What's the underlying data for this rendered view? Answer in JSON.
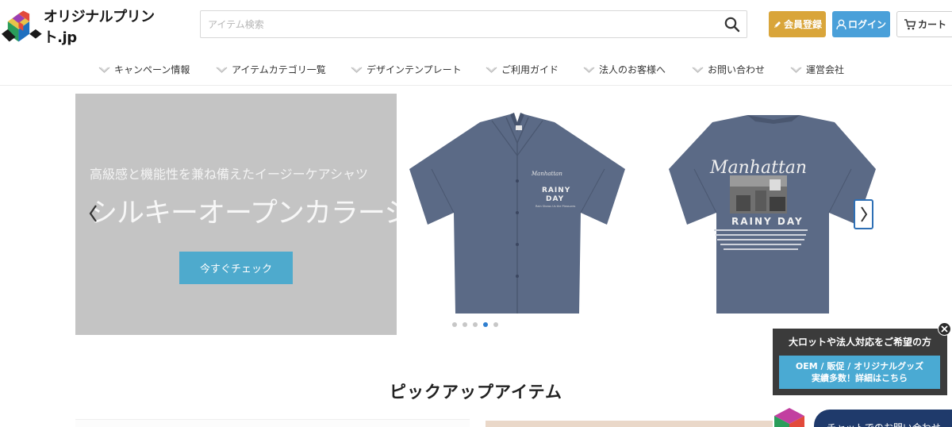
{
  "header": {
    "logo_text": "オリジナルプリント.jp",
    "search_placeholder": "アイテム検索",
    "register_label": "会員登録",
    "login_label": "ログイン",
    "cart_label": "カート"
  },
  "nav": {
    "items": [
      {
        "label": "キャンペーン情報"
      },
      {
        "label": "アイテムカテゴリ一覧"
      },
      {
        "label": "デザインテンプレート"
      },
      {
        "label": "ご利用ガイド"
      },
      {
        "label": "法人のお客様へ"
      },
      {
        "label": "お問い合わせ"
      },
      {
        "label": "運営会社"
      }
    ]
  },
  "hero": {
    "subtitle": "高級感と機能性を兼ね備えたイージーケアシャツ",
    "title": "シルキーオープンカラーシャツ",
    "cta_label": "今すぐチェック",
    "shirt_front_text_1": "RAINY",
    "shirt_front_text_2": "DAY",
    "shirt_back_script": "Manhattan",
    "shirt_back_text": "RAINY DAY",
    "slide_count": 5,
    "active_slide": 4
  },
  "pickup": {
    "title": "ピックアップアイテム"
  },
  "corporate_popup": {
    "title": "大ロットや法人対応をご希望の方",
    "button_line1": "OEM / 販促 / オリジナルグッズ",
    "button_line2": "実績多数！詳細はこちら"
  },
  "chat": {
    "label": "チャットでのお問い合わせ"
  },
  "colors": {
    "register": "#d9a53a",
    "login": "#4aa0d9",
    "cta": "#4eaacd",
    "popup_bg": "#3b3b3b",
    "chat_bg": "#1f3a6b",
    "shirt": "#5b6a86"
  },
  "icons": {
    "search": "search-icon",
    "register": "pencil-icon",
    "login": "user-icon",
    "cart": "cart-icon",
    "nav": "chevron-down-icon",
    "close": "close-icon"
  }
}
